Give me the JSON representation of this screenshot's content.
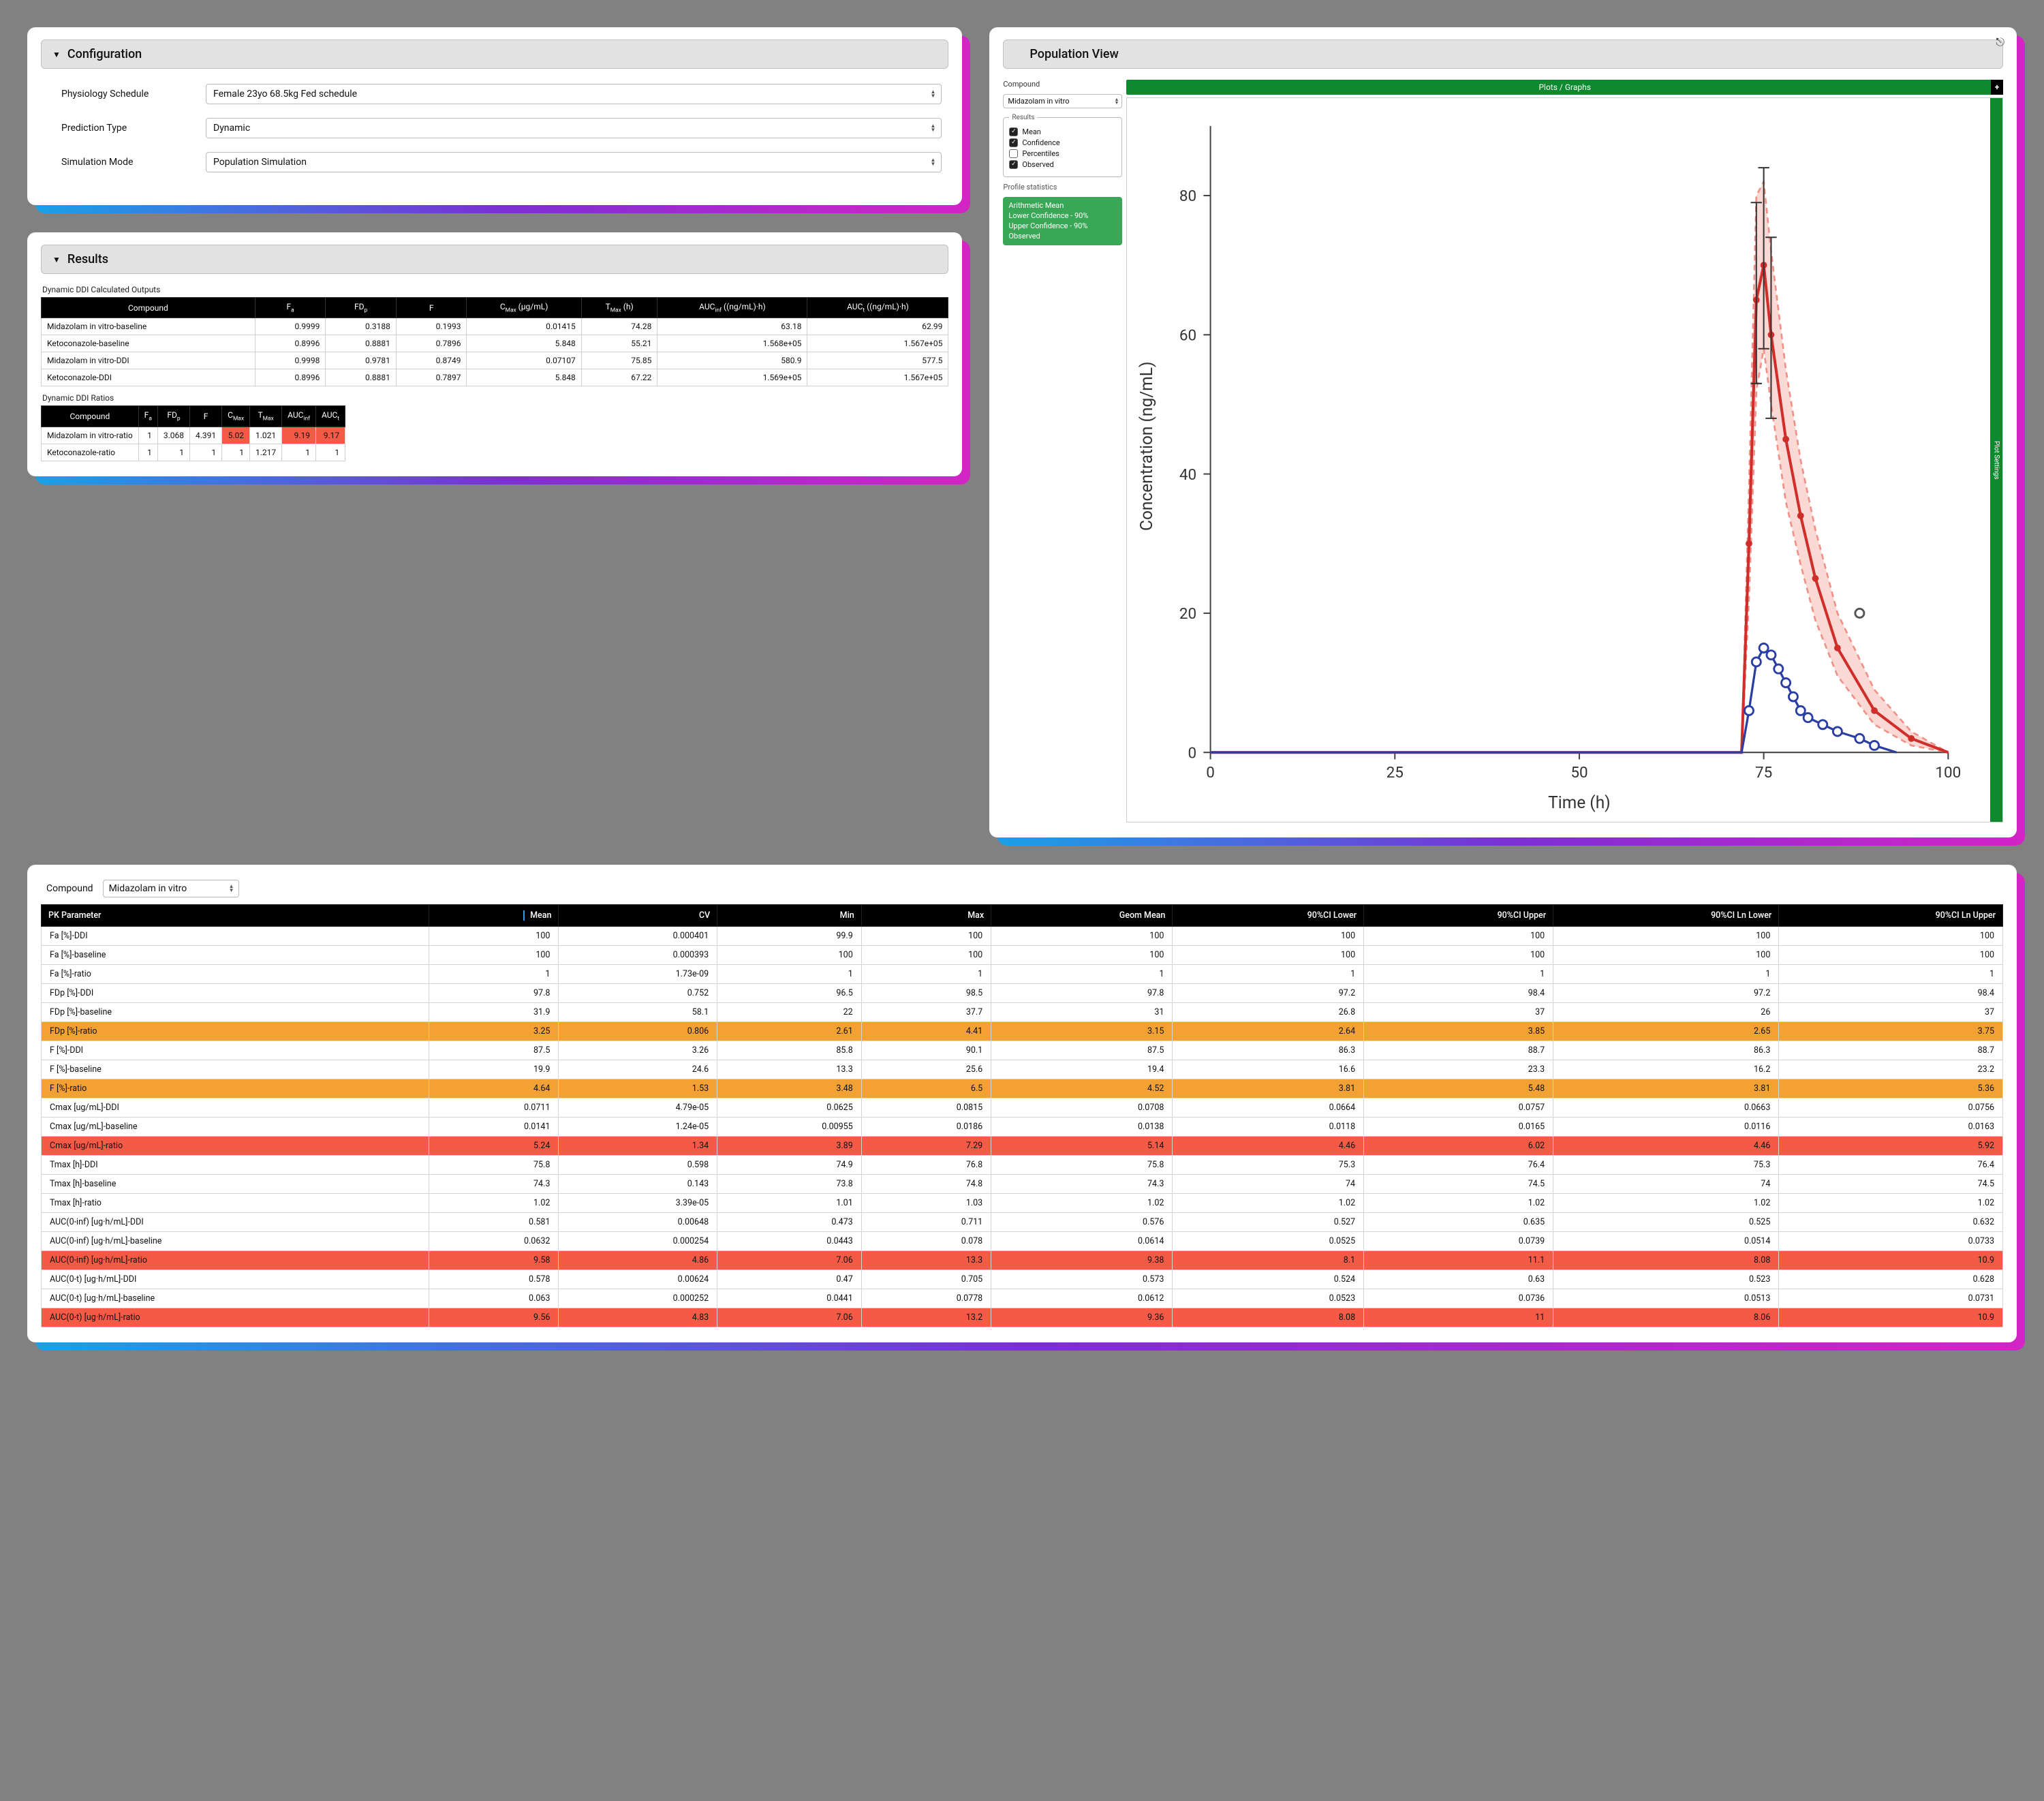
{
  "config": {
    "title": "Configuration",
    "rows": [
      {
        "label": "Physiology Schedule",
        "value": "Female 23yo 68.5kg Fed schedule"
      },
      {
        "label": "Prediction Type",
        "value": "Dynamic"
      },
      {
        "label": "Simulation Mode",
        "value": "Population Simulation"
      }
    ]
  },
  "results": {
    "title": "Results",
    "calc_title": "Dynamic DDI Calculated Outputs",
    "calc_headers": [
      "Compound",
      "Fₐ",
      "FDₚ",
      "F",
      "C_Max (µg/mL)",
      "T_Max (h)",
      "AUC_inf ((ng/mL)·h)",
      "AUC_t ((ng/mL)·h)"
    ],
    "calc_rows": [
      {
        "c": "Midazolam in vitro-baseline",
        "fa": "0.9999",
        "fdp": "0.3188",
        "f": "0.1993",
        "cmax": "0.01415",
        "tmax": "74.28",
        "aucinf": "63.18",
        "auct": "62.99"
      },
      {
        "c": "Ketoconazole-baseline",
        "fa": "0.8996",
        "fdp": "0.8881",
        "f": "0.7896",
        "cmax": "5.848",
        "tmax": "55.21",
        "aucinf": "1.568e+05",
        "auct": "1.567e+05"
      },
      {
        "c": "Midazolam in vitro-DDI",
        "fa": "0.9998",
        "fdp": "0.9781",
        "f": "0.8749",
        "cmax": "0.07107",
        "tmax": "75.85",
        "aucinf": "580.9",
        "auct": "577.5"
      },
      {
        "c": "Ketoconazole-DDI",
        "fa": "0.8996",
        "fdp": "0.8881",
        "f": "0.7897",
        "cmax": "5.848",
        "tmax": "67.22",
        "aucinf": "1.569e+05",
        "auct": "1.567e+05"
      }
    ],
    "ratio_title": "Dynamic DDI Ratios",
    "ratio_headers": [
      "Compound",
      "Fₐ",
      "FDₚ",
      "F",
      "C_Max",
      "T_Max",
      "AUC_inf",
      "AUC_t"
    ],
    "ratio_rows": [
      {
        "c": "Midazolam in vitro-ratio",
        "fa": "1",
        "fdp": "3.068",
        "f": "4.391",
        "cmax": "5.02",
        "tmax": "1.021",
        "aucinf": "9.19",
        "auct": "9.17",
        "hl": {
          "cmax": "red",
          "aucinf": "red",
          "auct": "red"
        }
      },
      {
        "c": "Ketoconazole-ratio",
        "fa": "1",
        "fdp": "1",
        "f": "1",
        "cmax": "1",
        "tmax": "1.217",
        "aucinf": "1",
        "auct": "1",
        "hl": {}
      }
    ]
  },
  "pop": {
    "title": "Population View",
    "compound_label": "Compound",
    "compound_value": "Midazolam in vitro",
    "results_legend_title": "Results",
    "checks": [
      {
        "label": "Mean",
        "checked": true
      },
      {
        "label": "Confidence",
        "checked": true
      },
      {
        "label": "Percentiles",
        "checked": false
      },
      {
        "label": "Observed",
        "checked": true
      }
    ],
    "stats_title": "Profile statistics",
    "stats_lines": [
      "Arithmetic Mean",
      "Lower Confidence - 90%",
      "Upper Confidence - 90%",
      "Observed"
    ],
    "plots_tab": "Plots / Graphs",
    "plot_settings": "Plot Settings",
    "xlabel": "Time (h)",
    "ylabel": "Concentration (ng/mL)",
    "xticks": [
      "0",
      "25",
      "50",
      "75",
      "100"
    ],
    "yticks": [
      "0",
      "20",
      "40",
      "60",
      "80"
    ]
  },
  "pk": {
    "compound_label": "Compound",
    "compound_value": "Midazolam in vitro",
    "headers": [
      "PK Parameter",
      "Mean",
      "CV",
      "Min",
      "Max",
      "Geom Mean",
      "90%CI Lower",
      "90%CI Upper",
      "90%CI Ln Lower",
      "90%CI Ln Upper"
    ],
    "rows": [
      {
        "p": "Fa [%]-DDI",
        "v": [
          "100",
          "0.000401",
          "99.9",
          "100",
          "100",
          "100",
          "100",
          "100",
          "100"
        ],
        "hl": null
      },
      {
        "p": "Fa [%]-baseline",
        "v": [
          "100",
          "0.000393",
          "100",
          "100",
          "100",
          "100",
          "100",
          "100",
          "100"
        ],
        "hl": null
      },
      {
        "p": "Fa [%]-ratio",
        "v": [
          "1",
          "1.73e-09",
          "1",
          "1",
          "1",
          "1",
          "1",
          "1",
          "1"
        ],
        "hl": null
      },
      {
        "p": "FDp [%]-DDI",
        "v": [
          "97.8",
          "0.752",
          "96.5",
          "98.5",
          "97.8",
          "97.2",
          "98.4",
          "97.2",
          "98.4"
        ],
        "hl": null
      },
      {
        "p": "FDp [%]-baseline",
        "v": [
          "31.9",
          "58.1",
          "22",
          "37.7",
          "31",
          "26.8",
          "37",
          "26",
          "37"
        ],
        "hl": null
      },
      {
        "p": "FDp [%]-ratio",
        "v": [
          "3.25",
          "0.806",
          "2.61",
          "4.41",
          "3.15",
          "2.64",
          "3.85",
          "2.65",
          "3.75"
        ],
        "hl": "orange"
      },
      {
        "p": "F [%]-DDI",
        "v": [
          "87.5",
          "3.26",
          "85.8",
          "90.1",
          "87.5",
          "86.3",
          "88.7",
          "86.3",
          "88.7"
        ],
        "hl": null
      },
      {
        "p": "F [%]-baseline",
        "v": [
          "19.9",
          "24.6",
          "13.3",
          "25.6",
          "19.4",
          "16.6",
          "23.3",
          "16.2",
          "23.2"
        ],
        "hl": null
      },
      {
        "p": "F [%]-ratio",
        "v": [
          "4.64",
          "1.53",
          "3.48",
          "6.5",
          "4.52",
          "3.81",
          "5.48",
          "3.81",
          "5.36"
        ],
        "hl": "orange"
      },
      {
        "p": "Cmax [ug/mL]-DDI",
        "v": [
          "0.0711",
          "4.79e-05",
          "0.0625",
          "0.0815",
          "0.0708",
          "0.0664",
          "0.0757",
          "0.0663",
          "0.0756"
        ],
        "hl": null
      },
      {
        "p": "Cmax [ug/mL]-baseline",
        "v": [
          "0.0141",
          "1.24e-05",
          "0.00955",
          "0.0186",
          "0.0138",
          "0.0118",
          "0.0165",
          "0.0116",
          "0.0163"
        ],
        "hl": null
      },
      {
        "p": "Cmax [ug/mL]-ratio",
        "v": [
          "5.24",
          "1.34",
          "3.89",
          "7.29",
          "5.14",
          "4.46",
          "6.02",
          "4.46",
          "5.92"
        ],
        "hl": "red"
      },
      {
        "p": "Tmax [h]-DDI",
        "v": [
          "75.8",
          "0.598",
          "74.9",
          "76.8",
          "75.8",
          "75.3",
          "76.4",
          "75.3",
          "76.4"
        ],
        "hl": null
      },
      {
        "p": "Tmax [h]-baseline",
        "v": [
          "74.3",
          "0.143",
          "73.8",
          "74.8",
          "74.3",
          "74",
          "74.5",
          "74",
          "74.5"
        ],
        "hl": null
      },
      {
        "p": "Tmax [h]-ratio",
        "v": [
          "1.02",
          "3.39e-05",
          "1.01",
          "1.03",
          "1.02",
          "1.02",
          "1.02",
          "1.02",
          "1.02"
        ],
        "hl": null
      },
      {
        "p": "AUC(0-inf) [ug·h/mL]-DDI",
        "v": [
          "0.581",
          "0.00648",
          "0.473",
          "0.711",
          "0.576",
          "0.527",
          "0.635",
          "0.525",
          "0.632"
        ],
        "hl": null
      },
      {
        "p": "AUC(0-inf) [ug·h/mL]-baseline",
        "v": [
          "0.0632",
          "0.000254",
          "0.0443",
          "0.078",
          "0.0614",
          "0.0525",
          "0.0739",
          "0.0514",
          "0.0733"
        ],
        "hl": null
      },
      {
        "p": "AUC(0-inf) [ug·h/mL]-ratio",
        "v": [
          "9.58",
          "4.86",
          "7.06",
          "13.3",
          "9.38",
          "8.1",
          "11.1",
          "8.08",
          "10.9"
        ],
        "hl": "red"
      },
      {
        "p": "AUC(0-t) [ug·h/mL]-DDI",
        "v": [
          "0.578",
          "0.00624",
          "0.47",
          "0.705",
          "0.573",
          "0.524",
          "0.63",
          "0.523",
          "0.628"
        ],
        "hl": null
      },
      {
        "p": "AUC(0-t) [ug·h/mL]-baseline",
        "v": [
          "0.063",
          "0.000252",
          "0.0441",
          "0.0778",
          "0.0612",
          "0.0523",
          "0.0736",
          "0.0513",
          "0.0731"
        ],
        "hl": null
      },
      {
        "p": "AUC(0-t) [ug·h/mL]-ratio",
        "v": [
          "9.56",
          "4.83",
          "7.06",
          "13.2",
          "9.36",
          "8.08",
          "11",
          "8.06",
          "10.9"
        ],
        "hl": "red"
      }
    ]
  },
  "chart_data": {
    "type": "line",
    "xlabel": "Time (h)",
    "ylabel": "Concentration (ng/mL)",
    "xlim": [
      0,
      100
    ],
    "ylim": [
      0,
      90
    ],
    "series": [
      {
        "name": "Mean (red)",
        "color": "#cf2e2a",
        "x": [
          0,
          72,
          73,
          74,
          75,
          76,
          78,
          80,
          82,
          85,
          90,
          95,
          100
        ],
        "y": [
          0,
          0,
          30,
          65,
          70,
          60,
          45,
          34,
          25,
          15,
          6,
          2,
          0
        ]
      },
      {
        "name": "Upper Confidence 90%",
        "color": "#f09188",
        "x": [
          0,
          72,
          73,
          74,
          75,
          76,
          78,
          80,
          82,
          85,
          90,
          95,
          100
        ],
        "y": [
          0,
          0,
          38,
          80,
          82,
          72,
          55,
          42,
          32,
          20,
          9,
          3,
          0
        ]
      },
      {
        "name": "Lower Confidence 90%",
        "color": "#f09188",
        "x": [
          0,
          72,
          73,
          74,
          75,
          76,
          78,
          80,
          82,
          85,
          90,
          95,
          100
        ],
        "y": [
          0,
          0,
          22,
          52,
          58,
          50,
          36,
          27,
          19,
          11,
          4,
          1,
          0
        ]
      },
      {
        "name": "Observed (blue)",
        "color": "#2b3ea3",
        "x": [
          0,
          72,
          73,
          74,
          75,
          76,
          77,
          78,
          79,
          80,
          81,
          83,
          85,
          88,
          90,
          93
        ],
        "y": [
          0,
          0,
          6,
          13,
          15,
          14,
          12,
          10,
          8,
          6,
          5,
          4,
          3,
          2,
          1,
          0
        ]
      }
    ],
    "outlier": {
      "x": 88,
      "y": 20
    }
  }
}
